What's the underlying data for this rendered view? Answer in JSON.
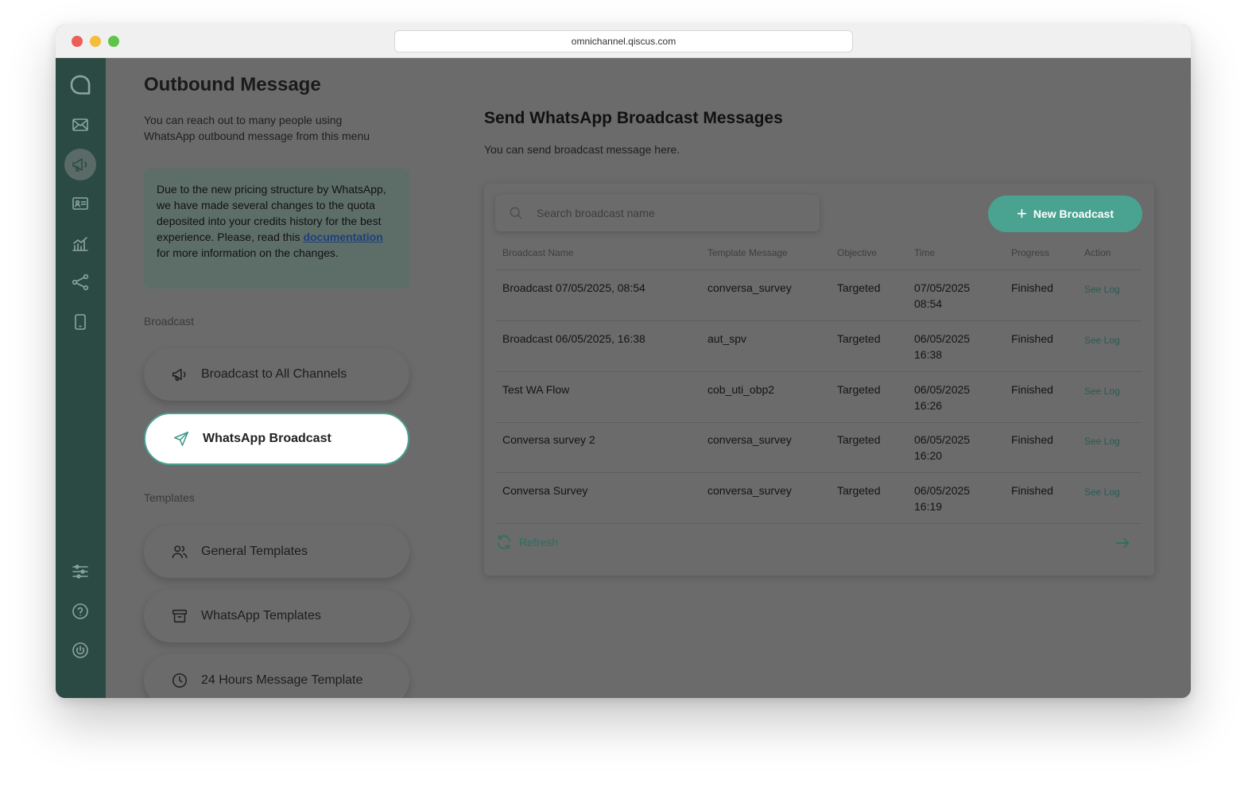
{
  "browser": {
    "url": "omnichannel.qiscus.com"
  },
  "rail": {
    "icons": [
      "qiscus-logo-icon",
      "inbox-icon",
      "megaphone-icon",
      "contact-card-icon",
      "analytics-icon",
      "integration-icon",
      "mobile-icon",
      "settings-sliders-icon",
      "help-icon",
      "power-icon"
    ],
    "active": "megaphone-icon"
  },
  "menu": {
    "title": "Outbound Message",
    "description": "You can reach out to many people using WhatsApp outbound message from this menu",
    "notice": {
      "before": "Due to the new pricing structure by WhatsApp, we have made several changes to the quota deposited into your credits history for the best experience. Please, read this ",
      "link": "documentation",
      "after": " for more information on the changes."
    },
    "broadcast_section": "Broadcast",
    "broadcast_items": [
      {
        "label": "Broadcast to All Channels",
        "icon": "megaphone-icon"
      },
      {
        "label": "WhatsApp Broadcast",
        "icon": "send-icon",
        "active": true
      }
    ],
    "templates_section": "Templates",
    "template_items": [
      {
        "label": "General Templates",
        "icon": "users-icon"
      },
      {
        "label": "WhatsApp Templates",
        "icon": "archive-icon"
      },
      {
        "label": "24 Hours Message Template",
        "icon": "clock-icon"
      }
    ]
  },
  "main": {
    "title": "Send WhatsApp Broadcast Messages",
    "description": "You can send broadcast message here.",
    "search": {
      "placeholder": "Search broadcast name",
      "value": ""
    },
    "new_button": "New Broadcast",
    "columns": [
      "Broadcast Name",
      "Template Message",
      "Objective",
      "Time",
      "Progress",
      "Action"
    ],
    "rows": [
      {
        "name": "Broadcast 07/05/2025, 08:54",
        "template": "conversa_survey",
        "objective": "Targeted",
        "time": "07/05/2025 08:54",
        "progress": "Finished",
        "action": "See Log"
      },
      {
        "name": "Broadcast 06/05/2025, 16:38",
        "template": "aut_spv",
        "objective": "Targeted",
        "time": "06/05/2025 16:38",
        "progress": "Finished",
        "action": "See Log"
      },
      {
        "name": "Test WA Flow",
        "template": "cob_uti_obp2",
        "objective": "Targeted",
        "time": "06/05/2025 16:26",
        "progress": "Finished",
        "action": "See Log"
      },
      {
        "name": "Conversa survey 2",
        "template": "conversa_survey",
        "objective": "Targeted",
        "time": "06/05/2025 16:20",
        "progress": "Finished",
        "action": "See Log"
      },
      {
        "name": "Conversa Survey",
        "template": "conversa_survey",
        "objective": "Targeted",
        "time": "06/05/2025 16:19",
        "progress": "Finished",
        "action": "See Log"
      }
    ],
    "refresh_label": "Refresh"
  },
  "colors": {
    "accent": "#4aa391",
    "rail": "#2b4a43",
    "overlay": "#6b6b6b"
  }
}
